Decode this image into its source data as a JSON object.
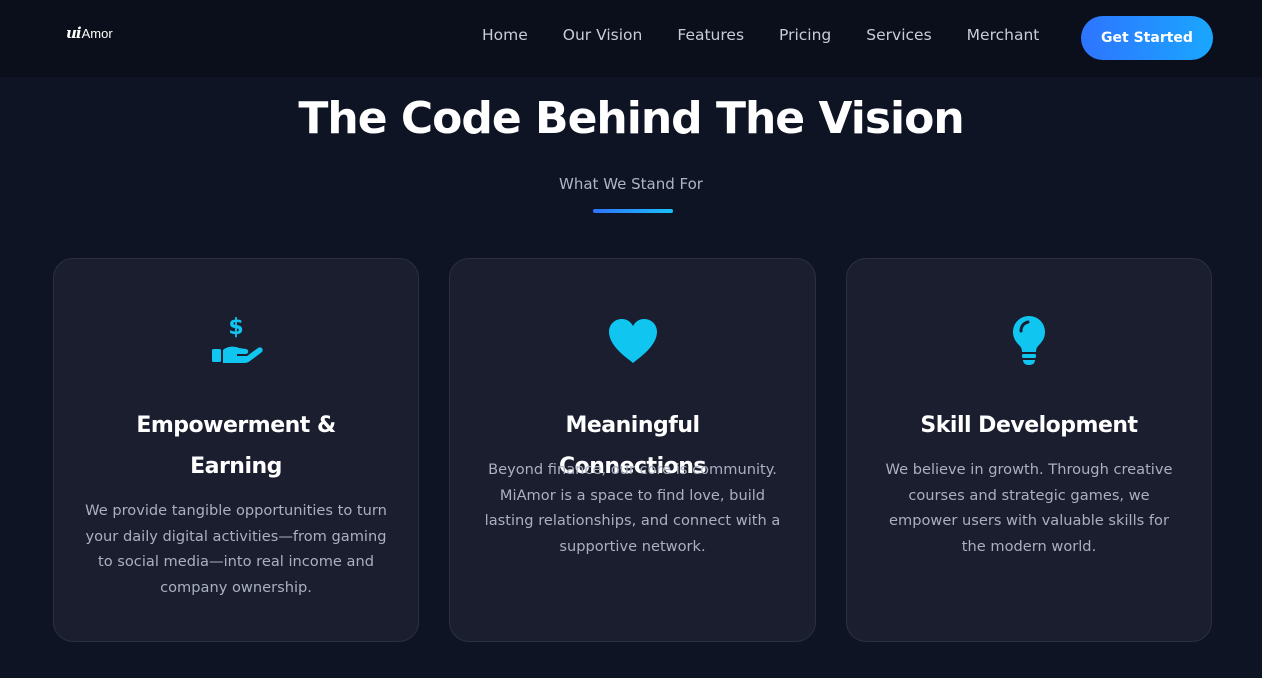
{
  "brand": {
    "mark": "ui",
    "name": "Amor"
  },
  "nav": {
    "links": [
      "Home",
      "Our Vision",
      "Features",
      "Pricing",
      "Services",
      "Merchant"
    ],
    "cta": "Get Started"
  },
  "hero": {
    "title": "The Code Behind The Vision",
    "subtitle": "What We Stand For"
  },
  "cards": [
    {
      "icon": "hand-dollar-icon",
      "title": "Empowerment & Earning",
      "desc": "We provide tangible opportunities to turn your daily digital activities—from gaming to social media—into real income and company ownership."
    },
    {
      "icon": "heart-icon",
      "title": "Meaningful Connections",
      "desc": "Beyond finance, our core is community. MiAmor is a space to find love, build lasting relationships, and connect with a supportive network."
    },
    {
      "icon": "lightbulb-icon",
      "title": "Skill Development",
      "desc": "We believe in growth. Through creative courses and strategic games, we empower users with valuable skills for the modern world."
    }
  ],
  "colors": {
    "background": "#0f1424",
    "navbar": "#0b0f1c",
    "card": "#1a1e2f",
    "accent_cyan": "#10c5f0",
    "accent_blue": "#2e74ff"
  }
}
